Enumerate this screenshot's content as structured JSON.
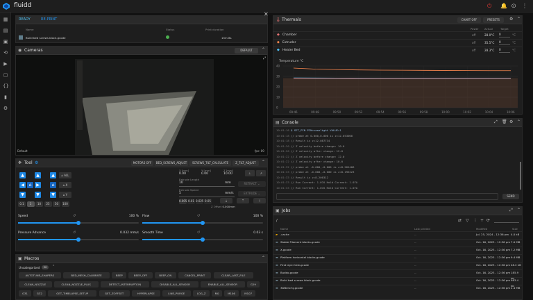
{
  "app": {
    "title": "fluidd"
  },
  "status": {
    "ready": "READY",
    "reprint": "RE-PRINT",
    "cols": [
      "Name",
      "Status",
      "Print duration"
    ],
    "file": "Build bed screws block.gcode",
    "duration": "15m 8s"
  },
  "cameras": {
    "title": "Cameras",
    "default_btn": "DEFAULT",
    "caption": "Default",
    "fps": "fps: 09"
  },
  "tool": {
    "title": "Tool",
    "buttons": [
      "MOTORS OFF",
      "BED_SCREWS_ADJUST",
      "SCREWS_TILT_CALCULATE",
      "Z_TILT_ADJUST"
    ],
    "pos": [
      {
        "label": "X [mm]",
        "val": "0.00"
      },
      {
        "label": "Y [mm]",
        "val": "0.00"
      },
      {
        "label": "Z [mm]",
        "val": "10.00"
      }
    ],
    "extrude_len_label": "Extrude Length",
    "extrude_len": "10",
    "extrude_unit": "mm",
    "extrude_speed_label": "Extrude Speed",
    "extrude_speed": "5",
    "speed_unit": "mm/s",
    "retract": "RETRACT",
    "extrude": "EXTRUDE",
    "zoffsets": [
      "0.005",
      "0.01",
      "0.025",
      "0.05"
    ],
    "zoffset_label": "Z Offset",
    "zoffset": "0.000mm",
    "steps": [
      "0.1",
      "1",
      "10",
      "25",
      "50",
      "100"
    ],
    "home_all": "ALL",
    "home_x": "X",
    "home_y": "Y"
  },
  "sliders": [
    {
      "label": "Speed",
      "value": "100 %",
      "frac": 0.5
    },
    {
      "label": "Flow",
      "value": "100 %",
      "frac": 0.5
    },
    {
      "label": "Pressure Advance",
      "value": "0.032 mm/s",
      "frac": 0.5
    },
    {
      "label": "Smooth Time",
      "value": "0.03 s",
      "frac": 0.5
    }
  ],
  "macros": {
    "title": "Macros",
    "group": "Uncategorized",
    "count": "30",
    "items": [
      "AUTOTUNE_SHAPERS",
      "BED_MESH_CALIBRATE",
      "BEEP",
      "BEEP_OFF",
      "BEEP_ON",
      "CANCEL_PRINT",
      "CLEAR_LAST_FILE",
      "CLEAN_NOZZLE",
      "CLEAN_NOZZLE_PLUS",
      "DETECT_INTERRUPTION",
      "DISABLE_ALL_SENSOR",
      "ENABLE_ALL_SENSOR",
      "G29",
      "G31",
      "G32",
      "GET_TIMELAPSE_SETUP",
      "GET_ZOFFSET",
      "HYPERLAPSE",
      "LINE_PURGE",
      "LOG_Z",
      "M0",
      "M106",
      "M107"
    ]
  },
  "thermals": {
    "title": "Thermals",
    "chart_off": "CHART OFF",
    "presets": "PRESETS",
    "cols": [
      "Power",
      "Actual",
      "Target"
    ],
    "rows": [
      {
        "name": "Chamber",
        "color": "#e57373",
        "power": "off",
        "actual": "28.0°C",
        "target": "0"
      },
      {
        "name": "Extruder",
        "color": "#ff8a50",
        "power": "off",
        "actual": "35.5°C",
        "target": "0"
      },
      {
        "name": "Heater Bed",
        "color": "#4fc3f7",
        "power": "off",
        "actual": "28.3°C",
        "target": "0"
      }
    ],
    "unit": "°C"
  },
  "chart_data": {
    "type": "line",
    "ylabel": "Temperature °C",
    "ylim": [
      0,
      40
    ],
    "yticks": [
      "40",
      "30",
      "20",
      "10",
      "0"
    ],
    "categories": [
      "09:46",
      "09:48",
      "09:50",
      "09:52",
      "09:54",
      "09:56",
      "09:58",
      "10:00",
      "10:02",
      "10:04",
      "10:06"
    ],
    "series": [
      {
        "name": "Extruder",
        "color": "#ff8a50",
        "values": [
          38,
          37,
          36.5,
          36.2,
          36,
          35.9,
          35.8,
          35.7,
          35.6,
          35.5,
          35.5
        ]
      },
      {
        "name": "Heater Bed",
        "color": "#4fc3f7",
        "values": [
          28.6,
          28.5,
          28.4,
          28.4,
          28.3,
          28.3,
          28.3,
          28.3,
          28.3,
          28.3,
          28.3
        ]
      },
      {
        "name": "Chamber",
        "color": "#e57373",
        "values": [
          28.2,
          28.1,
          28.1,
          28.0,
          28.0,
          28.0,
          28.0,
          28.0,
          28.0,
          28.0,
          28.0
        ]
      }
    ]
  },
  "console": {
    "title": "Console",
    "send": "SEND",
    "lines": [
      {
        "t": "10:01:16",
        "c": "$ SET_PIN PIN=caselight VALUE=1"
      },
      {
        "t": "10:01:18",
        "c": "// probe at 0.000,0.000 is z=12.053000"
      },
      {
        "t": "10:01:18",
        "c": "// Result is z=12.087734"
      },
      {
        "t": "10:01:20",
        "c": "// Z velocity before change: 10.0"
      },
      {
        "t": "10:01:20",
        "c": "// Z velocity after change: 12.0"
      },
      {
        "t": "10:01:22",
        "c": "// Z velocity before change: 12.0"
      },
      {
        "t": "10:01:22",
        "c": "// Z velocity after change: 10.0"
      },
      {
        "t": "10:01:32",
        "c": "// probe at -0.000,-0.000 is z=8.201406"
      },
      {
        "t": "10:01:33",
        "c": "// probe at -0.000,-0.000 is z=8.195223"
      },
      {
        "t": "10:01:33",
        "c": "// Result is z=8.200312"
      },
      {
        "t": "10:01:33",
        "c": "// Run Current: 1.07A Hold Current: 1.07A"
      },
      {
        "t": "10:01:33",
        "c": "// Run Current: 1.07A Hold Current: 1.07A"
      }
    ]
  },
  "jobs": {
    "title": "Jobs",
    "path": "/",
    "cols": [
      "Name",
      "Last printed",
      "Modified",
      "Size"
    ],
    "rows": [
      {
        "name": ".cache",
        "last": "--",
        "mod": "Jul. 25, 2024 - 12:36 pm",
        "size": "4.0 kB"
      },
      {
        "name": "Stable Filament blocks.gcode",
        "last": "--",
        "mod": "Oct. 16, 2023 - 12:36 pm",
        "size": "7.0 MB"
      },
      {
        "name": "X.gcode",
        "last": "--",
        "mod": "Oct. 16, 2023 - 12:36 pm",
        "size": "7.2 MB"
      },
      {
        "name": "Platform horizontal blocks.gcode",
        "last": "--",
        "mod": "Oct. 16, 2023 - 12:36 pm",
        "size": "9.4 MB"
      },
      {
        "name": "First layer test.gcode",
        "last": "--",
        "mod": "Oct. 16, 2023 - 12:36 pm",
        "size": "48.2 kB"
      },
      {
        "name": "Buddo.gcode",
        "last": "--",
        "mod": "Oct. 16, 2023 - 12:36 pm",
        "size": "185.9 kB"
      },
      {
        "name": "Build bed screws block.gcode",
        "last": "--",
        "mod": "Oct. 16, 2023 - 12:36 pm",
        "size": "983.4 kB"
      },
      {
        "name": "3DBenchy.gcode",
        "last": "--",
        "mod": "Oct. 16, 2023 - 12:36 pm",
        "size": "2.4 MB"
      }
    ]
  }
}
